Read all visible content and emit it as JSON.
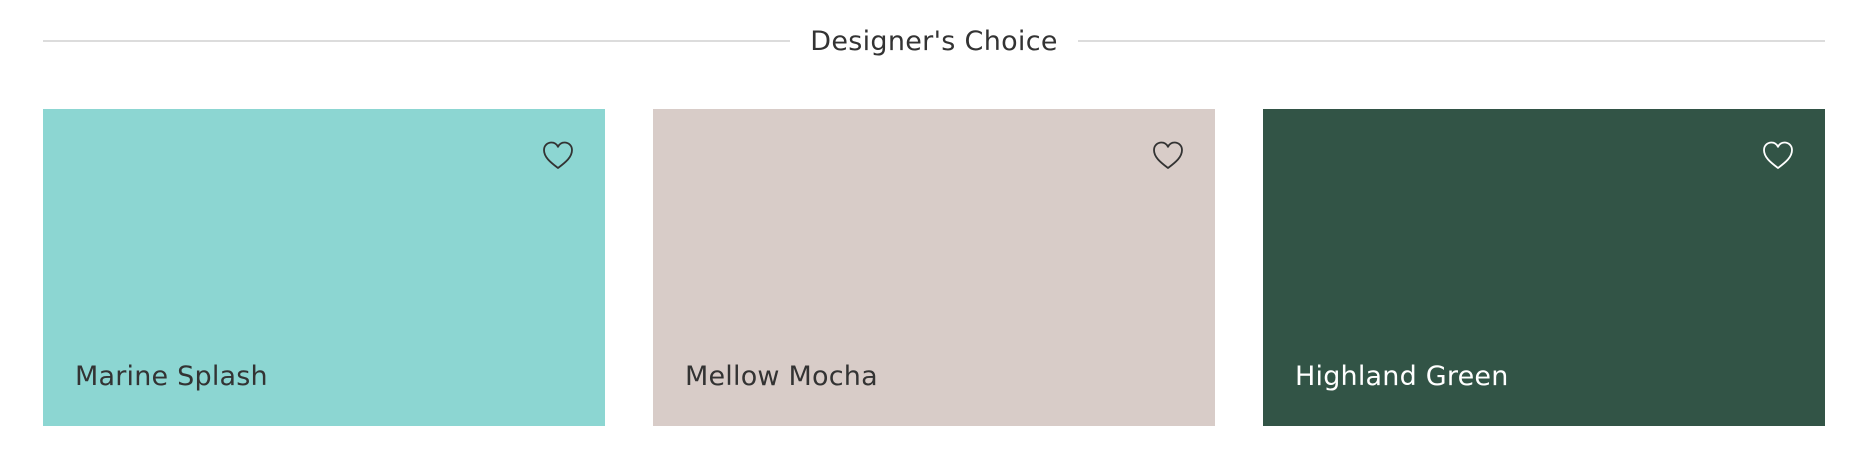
{
  "section": {
    "title": "Designer's Choice"
  },
  "cards": [
    {
      "name": "Marine Splash",
      "color": "#8cd6d2",
      "text_color": "#333333",
      "icon": "heart-icon"
    },
    {
      "name": "Mellow Mocha",
      "color": "#d8ccc8",
      "text_color": "#333333",
      "icon": "heart-icon"
    },
    {
      "name": "Highland Green",
      "color": "#325446",
      "text_color": "#ffffff",
      "icon": "heart-icon"
    }
  ]
}
